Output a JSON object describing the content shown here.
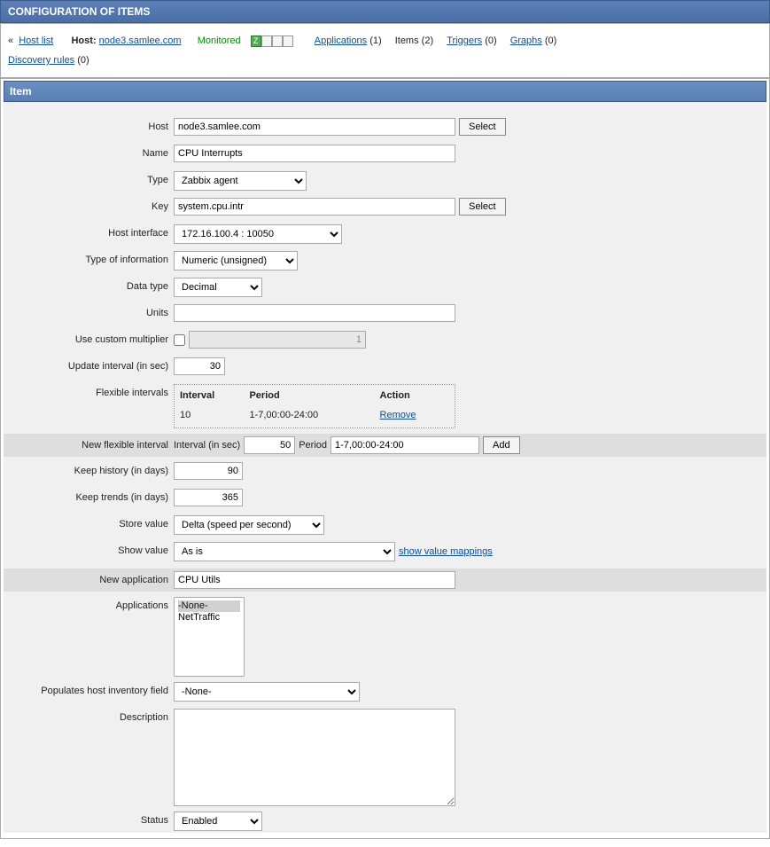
{
  "page_title": "CONFIGURATION OF ITEMS",
  "nav": {
    "host_list": "Host list",
    "host_label": "Host:",
    "host_name": "node3.samlee.com",
    "monitored": "Monitored",
    "status_first": "Z",
    "applications": "Applications",
    "applications_count": "(1)",
    "items": "Items",
    "items_count": "(2)",
    "triggers": "Triggers",
    "triggers_count": "(0)",
    "graphs": "Graphs",
    "graphs_count": "(0)",
    "discovery": "Discovery rules",
    "discovery_count": "(0)"
  },
  "panel_title": "Item",
  "labels": {
    "host": "Host",
    "name": "Name",
    "type": "Type",
    "key": "Key",
    "host_interface": "Host interface",
    "info_type": "Type of information",
    "data_type": "Data type",
    "units": "Units",
    "multiplier": "Use custom multiplier",
    "update_interval": "Update interval (in sec)",
    "flex_intervals": "Flexible intervals",
    "new_flex": "New flexible interval",
    "keep_history": "Keep history (in days)",
    "keep_trends": "Keep trends (in days)",
    "store_value": "Store value",
    "show_value": "Show value",
    "new_app": "New application",
    "applications": "Applications",
    "pop_inventory": "Populates host inventory field",
    "description": "Description",
    "status": "Status"
  },
  "values": {
    "host": "node3.samlee.com",
    "name": "CPU Interrupts",
    "type": "Zabbix agent",
    "key": "system.cpu.intr",
    "host_interface": "172.16.100.4 : 10050",
    "info_type": "Numeric (unsigned)",
    "data_type": "Decimal",
    "units": "",
    "multiplier_value": "1",
    "update_interval": "30",
    "keep_history": "90",
    "keep_trends": "365",
    "store_value": "Delta (speed per second)",
    "show_value": "As is",
    "new_app": "CPU Utils",
    "pop_inventory": "-None-",
    "description": "",
    "status": "Enabled"
  },
  "flex_table": {
    "h_interval": "Interval",
    "h_period": "Period",
    "h_action": "Action",
    "row_interval": "10",
    "row_period": "1-7,00:00-24:00",
    "row_action": "Remove"
  },
  "new_flex": {
    "interval_label": "Interval (in sec)",
    "interval_value": "50",
    "period_label": "Period",
    "period_value": "1-7,00:00-24:00",
    "add_btn": "Add"
  },
  "buttons": {
    "select": "Select"
  },
  "links": {
    "show_mappings": "show value mappings"
  },
  "app_options": {
    "none": "-None-",
    "nettraffic": "NetTraffic"
  }
}
